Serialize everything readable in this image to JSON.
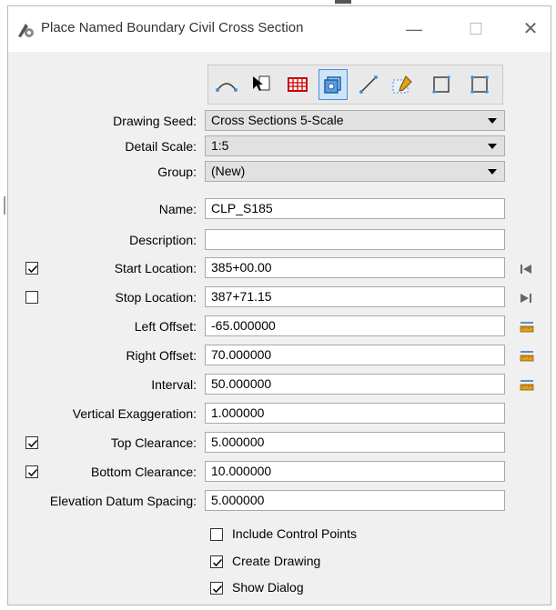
{
  "window": {
    "title": "Place Named Boundary Civil Cross Section",
    "minimize": "—",
    "maximize": "☐",
    "close": "✕"
  },
  "toolbar": {
    "tools": [
      "by-path-icon",
      "pointer-select-icon",
      "grid-icon",
      "cross-section-active-icon",
      "line-icon",
      "dashed-box-pencil-icon",
      "rectangle-icon",
      "shape-icon"
    ]
  },
  "form": {
    "drawing_seed": {
      "label": "Drawing Seed:",
      "value": "Cross Sections 5-Scale"
    },
    "detail_scale": {
      "label": "Detail Scale:",
      "value": "1:5"
    },
    "group": {
      "label": "Group:",
      "value": "(New)"
    },
    "name": {
      "label": "Name:",
      "value": "CLP_S185"
    },
    "description": {
      "label": "Description:",
      "value": ""
    },
    "start_location": {
      "label": "Start Location:",
      "value": "385+00.00",
      "checked": true
    },
    "stop_location": {
      "label": "Stop Location:",
      "value": "387+71.15",
      "checked": false
    },
    "left_offset": {
      "label": "Left Offset:",
      "value": "-65.000000"
    },
    "right_offset": {
      "label": "Right Offset:",
      "value": "70.000000"
    },
    "interval": {
      "label": "Interval:",
      "value": "50.000000"
    },
    "vertical_exaggeration": {
      "label": "Vertical Exaggeration:",
      "value": "1.000000"
    },
    "top_clearance": {
      "label": "Top Clearance:",
      "value": "5.000000",
      "checked": true
    },
    "bottom_clearance": {
      "label": "Bottom Clearance:",
      "value": "10.000000",
      "checked": true
    },
    "elevation_datum_spacing": {
      "label": "Elevation Datum Spacing:",
      "value": "5.000000"
    }
  },
  "options": {
    "include_control_points": {
      "label": "Include Control Points",
      "checked": false
    },
    "create_drawing": {
      "label": "Create Drawing",
      "checked": true
    },
    "show_dialog": {
      "label": "Show Dialog",
      "checked": true
    }
  },
  "colors": {
    "accent": "#4a90d9",
    "ruler": "#e0a020",
    "grid_red": "#cc0000"
  }
}
